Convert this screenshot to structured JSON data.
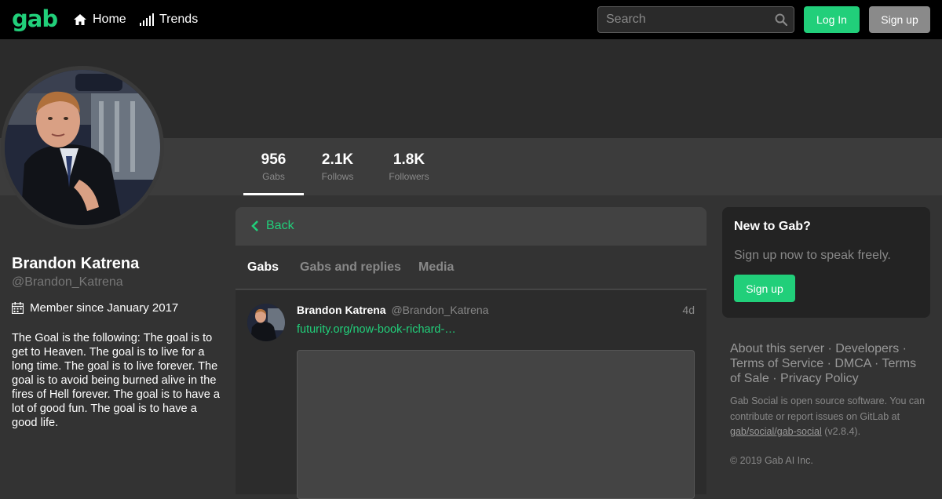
{
  "header": {
    "logo": "gab",
    "nav": [
      {
        "label": "Home",
        "icon": "home-icon"
      },
      {
        "label": "Trends",
        "icon": "signal-bars-icon"
      }
    ],
    "search_placeholder": "Search",
    "login_label": "Log In",
    "signup_label": "Sign up"
  },
  "profile": {
    "name": "Brandon Katrena",
    "handle": "@Brandon_Katrena",
    "member_since": "Member since January 2017",
    "bio": "The Goal is the following: The goal is to get to Heaven. The goal is to live for a long time. The goal is to live forever. The goal is to avoid being burned alive in the fires of Hell forever. The goal is to have a lot of good fun. The goal is to have a good life.",
    "stats": [
      {
        "value": "956",
        "label": "Gabs"
      },
      {
        "value": "2.1K",
        "label": "Follows"
      },
      {
        "value": "1.8K",
        "label": "Followers"
      }
    ]
  },
  "timeline": {
    "back_label": "Back",
    "tabs": [
      "Gabs",
      "Gabs and replies",
      "Media"
    ],
    "active_tab": "Gabs",
    "posts": [
      {
        "author_name": "Brandon Katrena",
        "author_handle": "@Brandon_Katrena",
        "time": "4d",
        "link_text": "futurity.org/now-book-richard-…"
      }
    ]
  },
  "sidebar": {
    "signup_title": "New to Gab?",
    "signup_text": "Sign up now to speak freely.",
    "signup_button": "Sign up",
    "footer_links": [
      "About this server",
      "Developers",
      "Terms of Service",
      "DMCA",
      "Terms of Sale",
      "Privacy Policy"
    ],
    "footer_info_prefix": "Gab Social is open source software. You can contribute or report issues on GitLab at ",
    "footer_repo": "gab/social/gab-social",
    "footer_version": " (v2.8.4).",
    "copyright": "© 2019 Gab AI Inc."
  },
  "colors": {
    "accent": "#21cf7a",
    "topbar": "#000000",
    "background": "#333333"
  }
}
